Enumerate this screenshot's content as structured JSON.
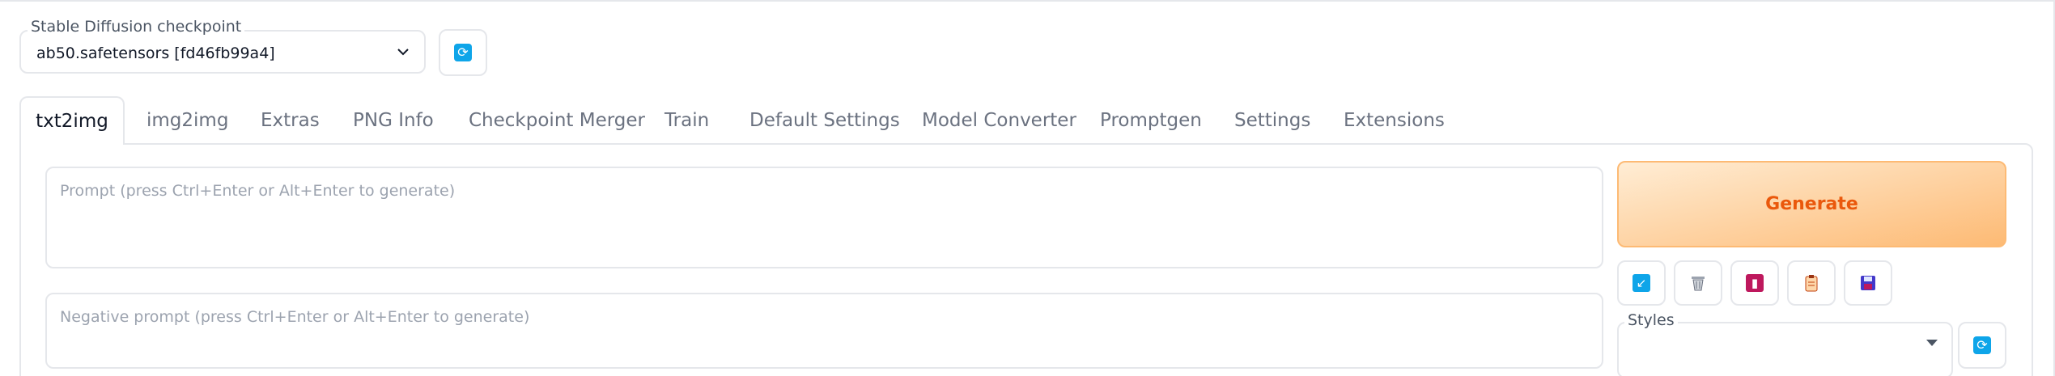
{
  "checkpoint": {
    "label": "Stable Diffusion checkpoint",
    "value": "ab50.safetensors [fd46fb99a4]"
  },
  "tabs": [
    {
      "label": "txt2img",
      "active": true
    },
    {
      "label": "img2img"
    },
    {
      "label": "Extras"
    },
    {
      "label": "PNG Info"
    },
    {
      "label": "Checkpoint Merger"
    },
    {
      "label": "Train"
    },
    {
      "label": "Default Settings"
    },
    {
      "label": "Model Converter"
    },
    {
      "label": "Promptgen"
    },
    {
      "label": "Settings"
    },
    {
      "label": "Extensions"
    }
  ],
  "prompt": {
    "placeholder": "Prompt (press Ctrl+Enter or Alt+Enter to generate)"
  },
  "negative_prompt": {
    "placeholder": "Negative prompt (press Ctrl+Enter or Alt+Enter to generate)"
  },
  "generate": {
    "label": "Generate"
  },
  "tool_icons": [
    "paste-arrow-icon",
    "trash-icon",
    "bookmark-icon",
    "clipboard-icon",
    "save-icon"
  ],
  "styles": {
    "label": "Styles",
    "selected": ""
  },
  "colors": {
    "accent_blue": "#0ea5e9",
    "generate_text": "#ea580c",
    "generate_bg_start": "#ffedd5",
    "generate_bg_end": "#fdba74",
    "border": "#e5e7eb"
  }
}
